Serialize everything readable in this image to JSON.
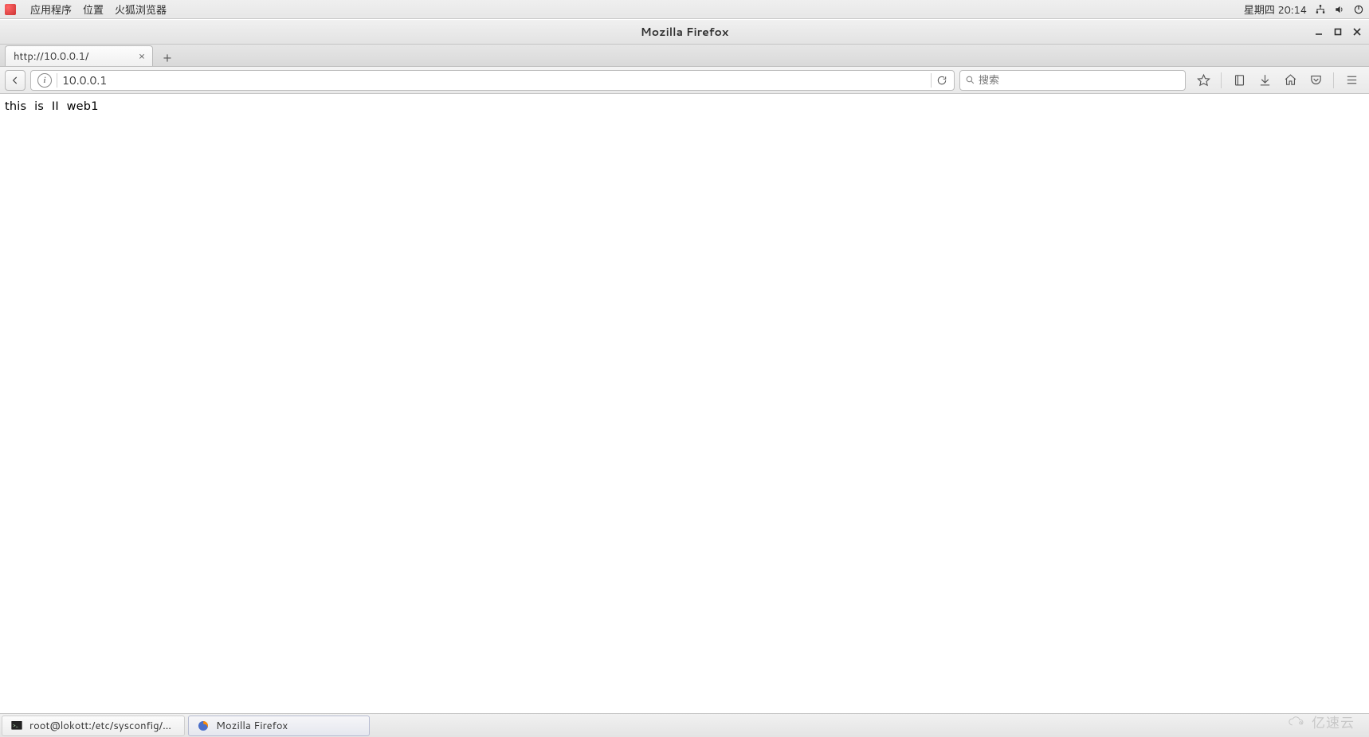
{
  "gnome_panel": {
    "menus": {
      "applications": "应用程序",
      "places": "位置",
      "browser": "火狐浏览器"
    },
    "datetime": "星期四 20:14"
  },
  "window": {
    "title": "Mozilla Firefox"
  },
  "tabs": {
    "items": [
      {
        "label": "http://10.0.0.1/"
      }
    ]
  },
  "navbar": {
    "url": "10.0.0.1",
    "search_placeholder": "搜索"
  },
  "page": {
    "body_text": "this is II web1"
  },
  "taskbar": {
    "items": [
      {
        "label": "root@lokott:/etc/sysconfig/networ…",
        "type": "terminal"
      },
      {
        "label": "Mozilla Firefox",
        "type": "firefox"
      }
    ]
  },
  "watermark": "亿速云"
}
